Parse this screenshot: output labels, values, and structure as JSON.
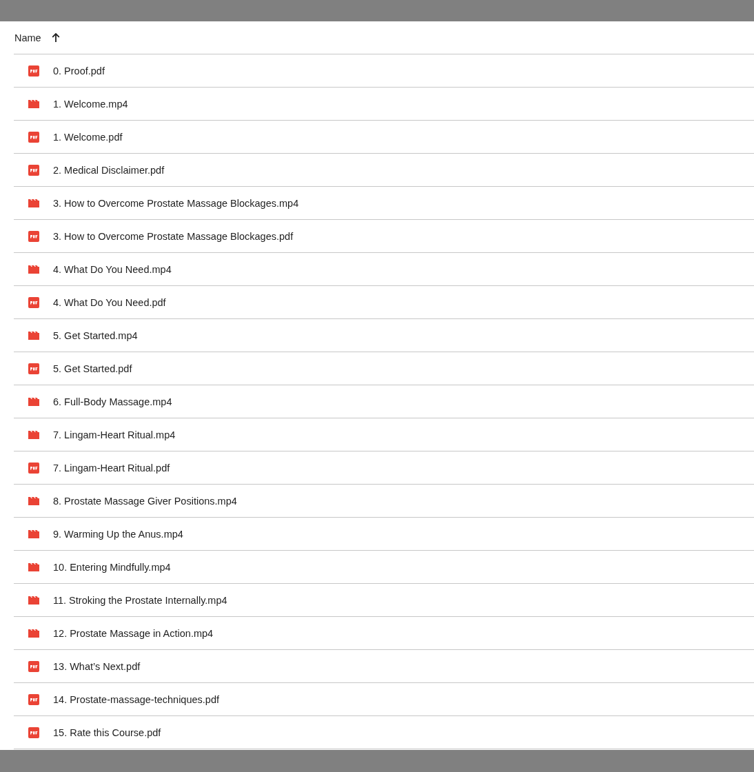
{
  "header": {
    "label": "Name",
    "sort_ascending": true
  },
  "files": [
    {
      "name": "0. Proof.pdf",
      "kind": "pdf"
    },
    {
      "name": "1. Welcome.mp4",
      "kind": "video"
    },
    {
      "name": "1. Welcome.pdf",
      "kind": "pdf"
    },
    {
      "name": "2. Medical Disclaimer.pdf",
      "kind": "pdf"
    },
    {
      "name": "3. How to Overcome Prostate Massage Blockages.mp4",
      "kind": "video"
    },
    {
      "name": "3. How to Overcome Prostate Massage Blockages.pdf",
      "kind": "pdf"
    },
    {
      "name": "4. What Do You Need.mp4",
      "kind": "video"
    },
    {
      "name": "4. What Do You Need.pdf",
      "kind": "pdf"
    },
    {
      "name": "5. Get Started.mp4",
      "kind": "video"
    },
    {
      "name": "5. Get Started.pdf",
      "kind": "pdf"
    },
    {
      "name": "6. Full-Body Massage.mp4",
      "kind": "video"
    },
    {
      "name": "7. Lingam-Heart Ritual.mp4",
      "kind": "video"
    },
    {
      "name": "7. Lingam-Heart Ritual.pdf",
      "kind": "pdf"
    },
    {
      "name": "8. Prostate Massage Giver Positions.mp4",
      "kind": "video"
    },
    {
      "name": "9. Warming Up the Anus.mp4",
      "kind": "video"
    },
    {
      "name": "10. Entering Mindfully.mp4",
      "kind": "video"
    },
    {
      "name": "11. Stroking the Prostate Internally.mp4",
      "kind": "video"
    },
    {
      "name": "12. Prostate Massage in Action.mp4",
      "kind": "video"
    },
    {
      "name": "13. What’s Next.pdf",
      "kind": "pdf"
    },
    {
      "name": "14. Prostate-massage-techniques.pdf",
      "kind": "pdf"
    },
    {
      "name": "15. Rate this Course.pdf",
      "kind": "pdf"
    }
  ]
}
